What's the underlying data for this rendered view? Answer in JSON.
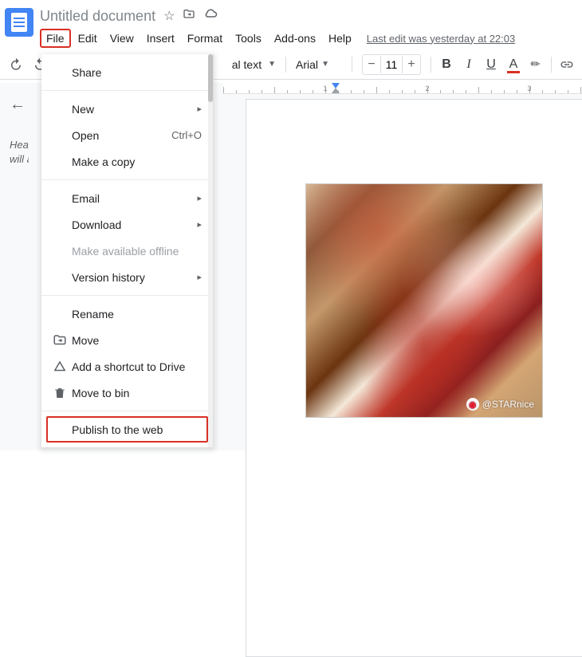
{
  "header": {
    "doc_title": "Untitled document",
    "last_edit": "Last edit was yesterday at 22:03"
  },
  "menubar": {
    "file": "File",
    "edit": "Edit",
    "view": "View",
    "insert": "Insert",
    "format": "Format",
    "tools": "Tools",
    "addons": "Add-ons",
    "help": "Help"
  },
  "toolbar": {
    "style": "al text",
    "font": "Arial",
    "size": "11",
    "bold": "B",
    "italic": "I",
    "underline": "U",
    "text_color": "A"
  },
  "outline": {
    "text1": "Head",
    "text2": "will a"
  },
  "file_menu": {
    "share": "Share",
    "new": "New",
    "open": "Open",
    "open_shortcut": "Ctrl+O",
    "make_copy": "Make a copy",
    "email": "Email",
    "download": "Download",
    "offline": "Make available offline",
    "version_history": "Version history",
    "rename": "Rename",
    "move": "Move",
    "add_shortcut": "Add a shortcut to Drive",
    "move_bin": "Move to bin",
    "publish": "Publish to the web"
  },
  "image": {
    "watermark": "@STARnice"
  }
}
